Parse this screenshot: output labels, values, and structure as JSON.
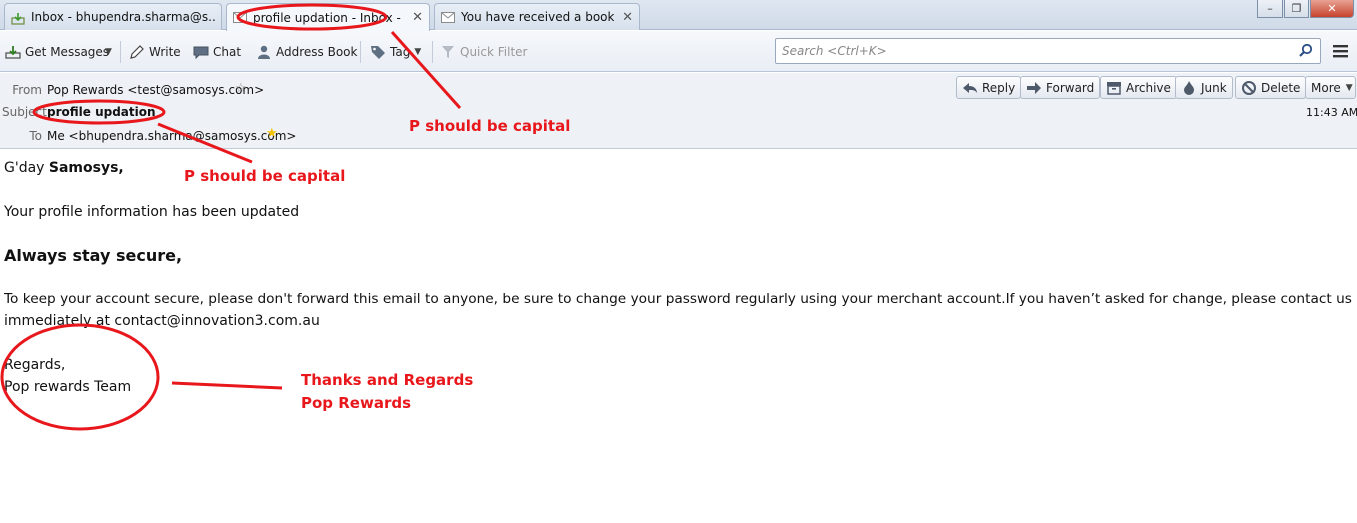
{
  "tabs": [
    {
      "label": "Inbox - bhupendra.sharma@s..."
    },
    {
      "label": "profile updation - Inbox - ..."
    },
    {
      "label": "You have received a booki..."
    }
  ],
  "window": {
    "minimize": "–",
    "restore": "❐",
    "close": "✕"
  },
  "toolbar": {
    "get_messages": "Get Messages",
    "write": "Write",
    "chat": "Chat",
    "address_book": "Address Book",
    "tag": "Tag",
    "quick_filter": "Quick Filter",
    "search_placeholder": "Search <Ctrl+K>"
  },
  "header": {
    "from_label": "From",
    "from_value": "Pop Rewards <test@samosys.com>",
    "subject_label": "Subject",
    "subject_value": "profile updation",
    "to_label": "To",
    "to_value": "Me <bhupendra.sharma@samosys.com>",
    "time": "11:43 AM",
    "actions": {
      "reply": "Reply",
      "forward": "Forward",
      "archive": "Archive",
      "junk": "Junk",
      "delete": "Delete",
      "more": "More"
    }
  },
  "message": {
    "greeting_prefix": "G'day ",
    "greeting_name": "Samosys,",
    "line1": "Your profile information has been updated",
    "heading": "Always stay secure,",
    "para_line1": "To keep your account secure, please don't forward this email to anyone, be sure to change your password regularly using your merchant account.If you haven’t asked for change, please contact us",
    "para_line2": "immediately at contact@innovation3.com.au",
    "regards": "Regards,",
    "team": "Pop rewards Team"
  },
  "annotations": {
    "note1": "P should be capital",
    "note2": "P should be capital",
    "note3_line1": "Thanks and Regards",
    "note3_line2": "Pop Rewards",
    "color": "#e8171c"
  }
}
